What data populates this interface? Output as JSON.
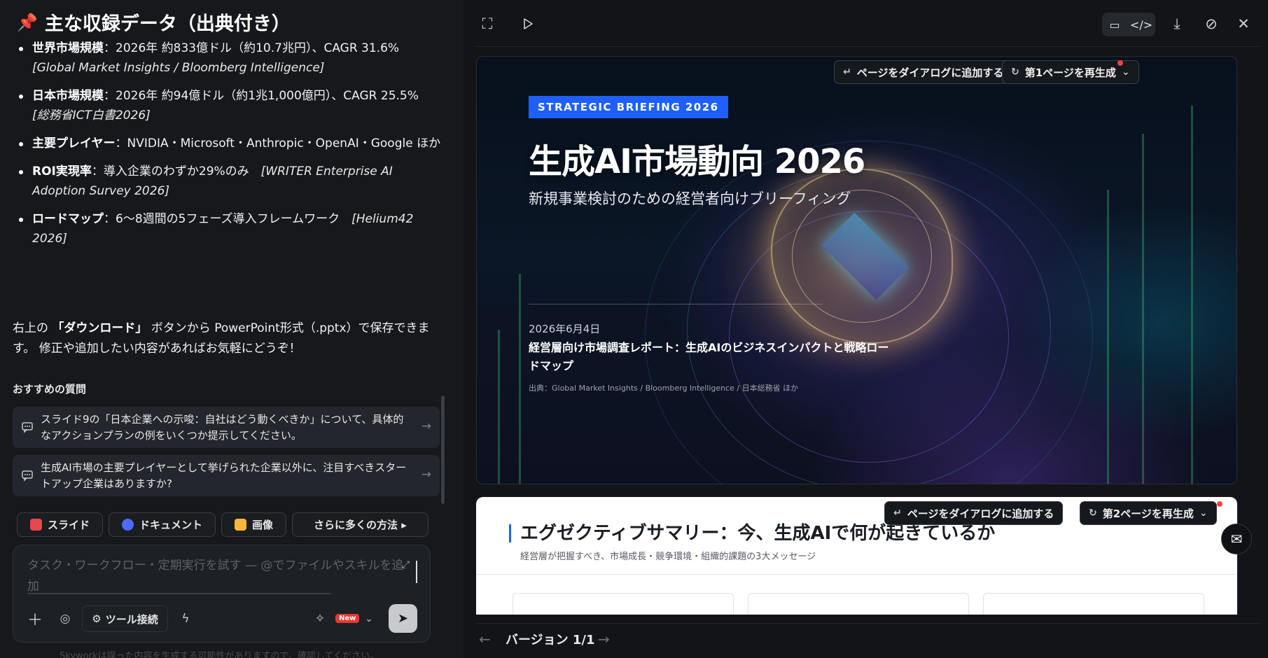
{
  "left": {
    "heading": "主な収録データ（出典付き）",
    "heading_icon": "pushpin-icon",
    "bullets": [
      {
        "label": "世界市場規模",
        "sep": "：",
        "text": "2026年 約833億ドル（約10.7兆円）、CAGR 31.6%",
        "source": "[Global Market Insights / Bloomberg Intelligence]"
      },
      {
        "label": "日本市場規模",
        "sep": "：",
        "text": "2026年 約94億ドル（約1兆1,000億円）、CAGR 25.5%",
        "source": "[総務省ICT白書2026]"
      },
      {
        "label": "主要プレイヤー",
        "sep": "：",
        "text": "NVIDIA・Microsoft・Anthropic・OpenAI・Google ほか",
        "source": ""
      },
      {
        "label": "ROI実現率",
        "sep": "：",
        "text": "導入企業のわずか29%のみ　",
        "source": "[WRITER Enterprise AI Adoption Survey 2026]"
      },
      {
        "label": "ロードマップ",
        "sep": "：",
        "text": "6〜8週間の5フェーズ導入フレームワーク　",
        "source": "[Helium42 2026]"
      }
    ],
    "closing_pre": "右上の",
    "closing_bold": "「ダウンロード」",
    "closing_post": "ボタンから PowerPoint形式（.pptx）で保存できます。 修正や追加したい内容があればお気軽にどうぞ！",
    "suggestions_title": "おすすめの質問",
    "suggestions": [
      "スライド9の「日本企業への示唆：自社はどう動くべきか」について、具体的なアクションプランの例をいくつか提示してください。",
      "生成AI市場の主要プレイヤーとして挙げられた企業以外に、注目すべきスタートアップ企業はありますか?"
    ],
    "chips": [
      {
        "label": "スライド",
        "icon": "slides-icon",
        "color": "#e5484d"
      },
      {
        "label": "ドキュメント",
        "icon": "document-icon",
        "color": "#4f6bff"
      },
      {
        "label": "画像",
        "icon": "image-icon",
        "color": "#f5b83d"
      },
      {
        "label": "さらに多くの方法 ▸",
        "icon": "",
        "color": ""
      }
    ],
    "input_placeholder": "タスク・ワークフロー・定期実行を試す — @でファイルやスキルを追加",
    "tool_connect_label": "ツール接続",
    "new_badge": "New",
    "disclaimer": "Skyworkは誤った内容を生成する可能性がありますので、確認してください。"
  },
  "right": {
    "version_label": "バージョン 1/1",
    "slide1": {
      "badge": "STRATEGIC BRIEFING 2026",
      "title": "生成AI市場動向 2026",
      "subtitle": "新規事業検討のための経営者向けブリーフィング",
      "date": "2026年6月4日",
      "report": "経営層向け市場調査レポート：生成AIのビジネスインパクトと戦略ロードマップ",
      "source": "出典：Global Market Insights / Bloomberg Intelligence / 日本総務省 ほか",
      "add_to_dialog": "ページをダイアログに追加する",
      "regenerate": "第1ページを再生成"
    },
    "slide2": {
      "title": "エグゼクティブサマリー：今、生成AIで何が起きているか",
      "subtitle": "経営層が把握すべき、市場成長・競争環境・組織的課題の3大メッセージ",
      "add_to_dialog": "ページをダイアログに追加する",
      "regenerate": "第2ページを再生成"
    }
  },
  "colors": {
    "accent_blue": "#1f5fff",
    "notify_red": "#ef4444",
    "bg_dark": "#16181c"
  }
}
